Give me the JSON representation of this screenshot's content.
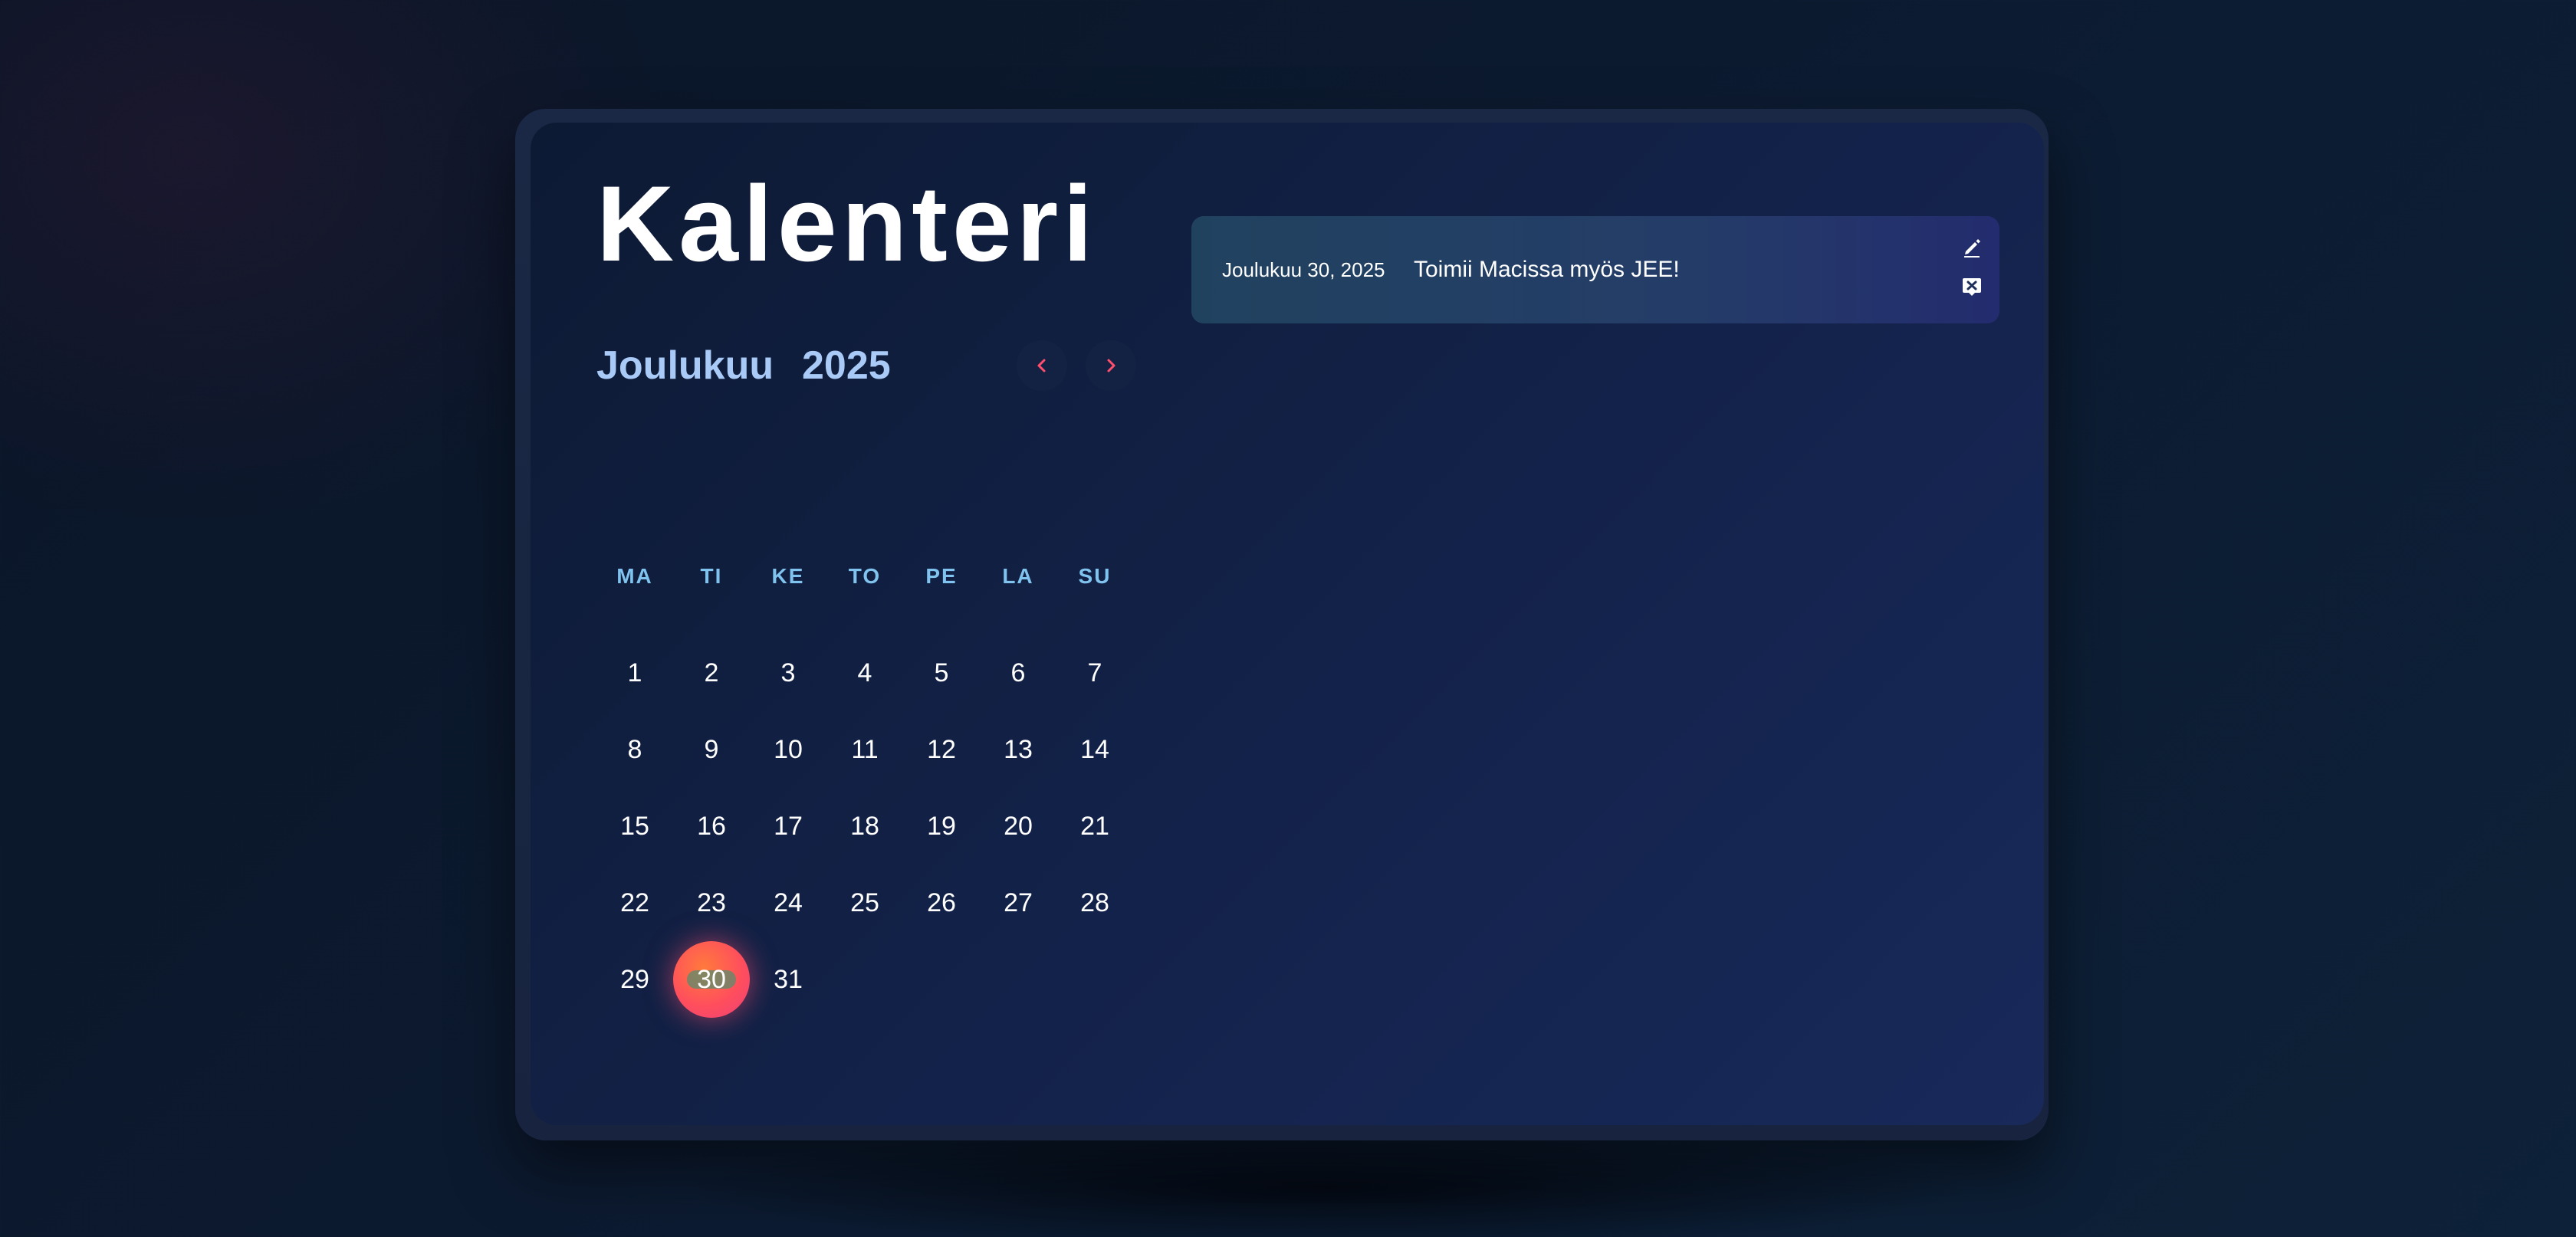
{
  "app": {
    "title": "Kalenteri"
  },
  "calendar": {
    "month": "Joulukuu",
    "year": "2025",
    "prev_icon": "chevron-left-icon",
    "next_icon": "chevron-right-icon",
    "weekdays": [
      "MA",
      "TI",
      "KE",
      "TO",
      "PE",
      "LA",
      "SU"
    ],
    "days": [
      "1",
      "2",
      "3",
      "4",
      "5",
      "6",
      "7",
      "8",
      "9",
      "10",
      "11",
      "12",
      "13",
      "14",
      "15",
      "16",
      "17",
      "18",
      "19",
      "20",
      "21",
      "22",
      "23",
      "24",
      "25",
      "26",
      "27",
      "28",
      "29",
      "30",
      "31"
    ],
    "selected_day": "30",
    "colors": {
      "accent": "#ff4f6e",
      "month_text": "#a9c9f6",
      "weekday_text": "#7fc3ee"
    }
  },
  "events": [
    {
      "date": "Joulukuu 30, 2025",
      "text": "Toimii Macissa myös JEE!",
      "edit_icon": "pencil-icon",
      "delete_icon": "delete-icon"
    }
  ]
}
